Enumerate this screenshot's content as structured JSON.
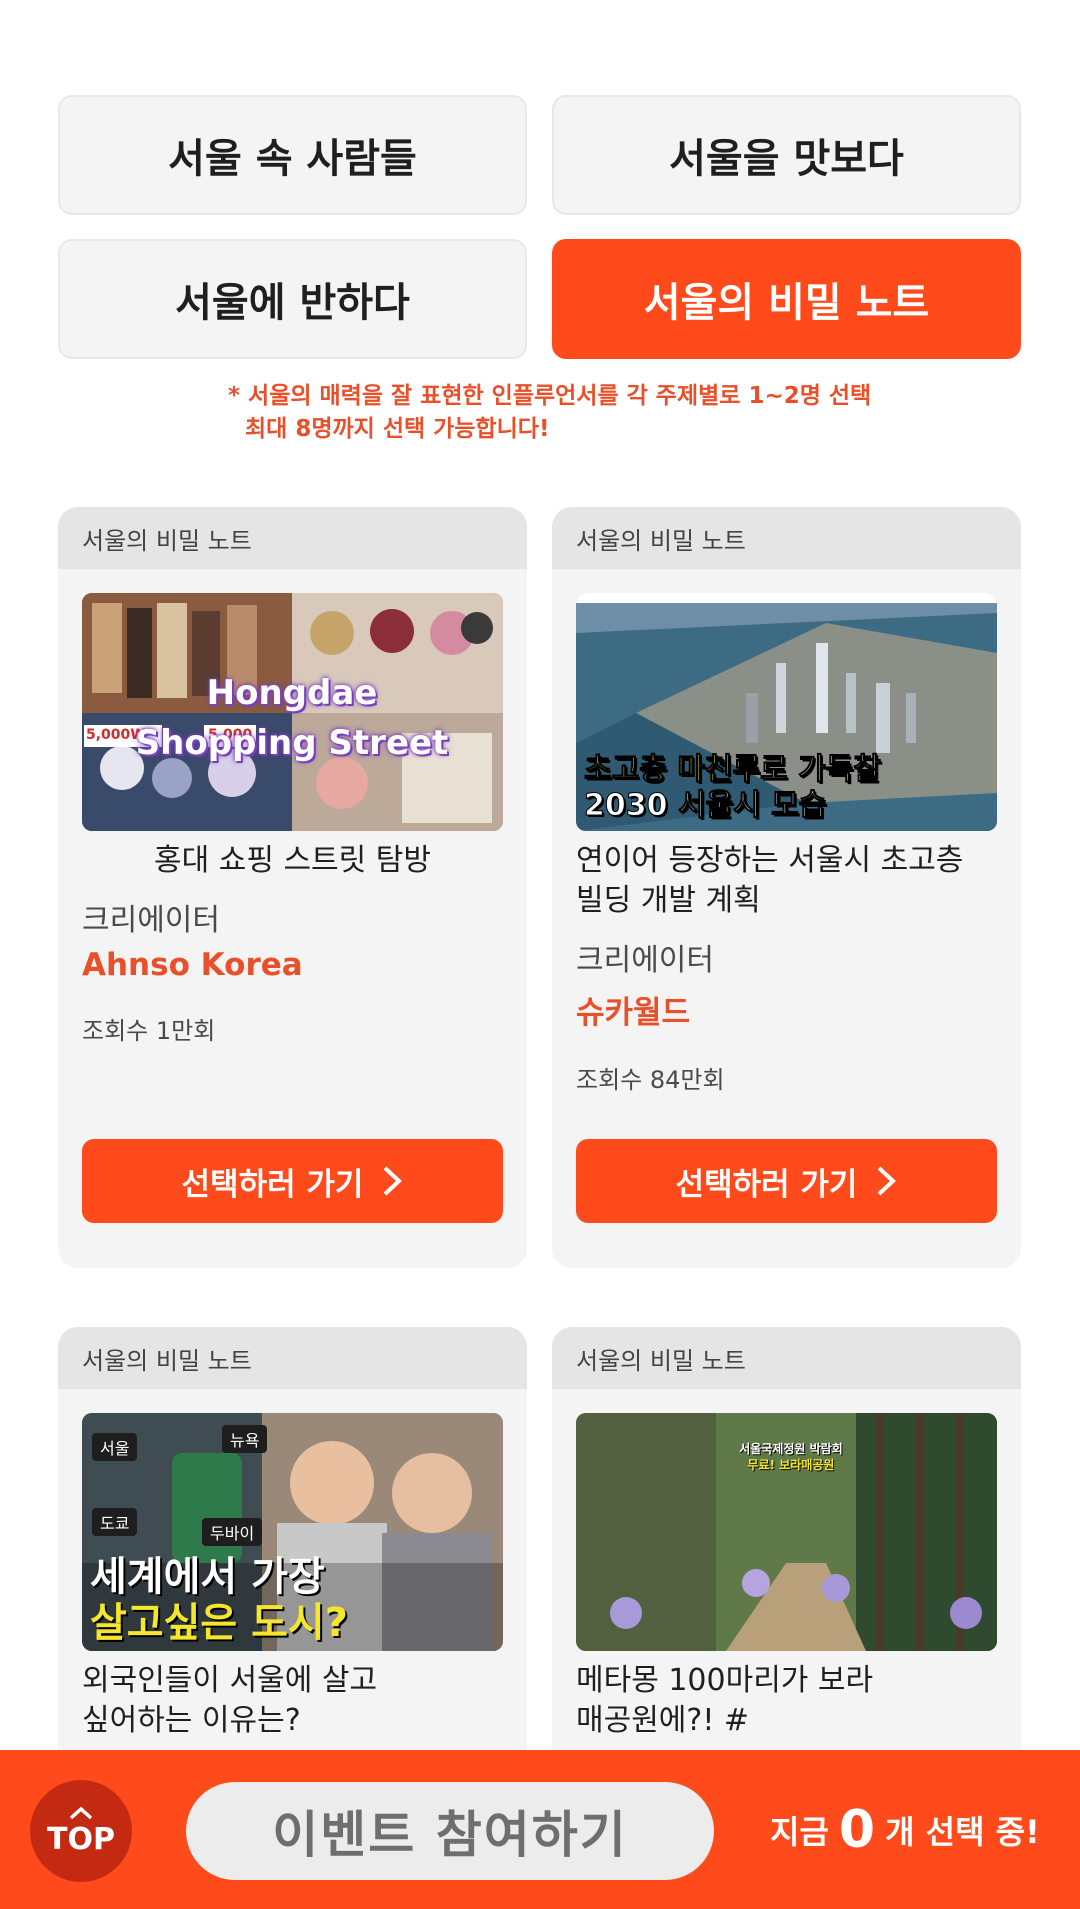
{
  "tabs": [
    {
      "label": "서울 속 사람들",
      "active": false
    },
    {
      "label": "서울을 맛보다",
      "active": false
    },
    {
      "label": "서울에 반하다",
      "active": false
    },
    {
      "label": "서울의 비밀 노트",
      "active": true
    }
  ],
  "notice": {
    "line1": "* 서울의 매력을 잘 표현한 인플루언서를 각 주제별로 1~2명 선택",
    "line2": "최대 8명까지 선택 가능합니다!"
  },
  "cards": [
    {
      "category": "서울의 비밀 노트",
      "thumb_caption": "Hongdae Shopping Street",
      "thumb_price_tags": [
        "5,000W",
        "5,000"
      ],
      "title": "홍대 쇼핑 스트릿 탐방",
      "creator_label": "크리에이터",
      "creator_name": "Ahnso Korea",
      "views": "조회수 1만회",
      "button_label": "선택하러 가기"
    },
    {
      "category": "서울의 비밀 노트",
      "thumb_caption_highlight": "초고층 마천루",
      "thumb_caption_rest": "로 가득찰",
      "thumb_caption_line2": "2030 서울시 모습",
      "title": "연이어 등장하는 서울시 초고층 빌딩 개발 계획",
      "creator_label": "크리에이터",
      "creator_name": "슈카월드",
      "views": "조회수 84만회",
      "button_label": "선택하러 가기"
    },
    {
      "category": "서울의 비밀 노트",
      "thumb_tags": [
        "서울",
        "뉴욕",
        "도쿄",
        "두바이"
      ],
      "thumb_caption_line1": "세계에서 가장",
      "thumb_caption_line2": "살고싶은 도시?",
      "title": "외국인들이 서울에 살고 싶어하는 이유는?"
    },
    {
      "category": "서울의 비밀 노트",
      "thumb_caption_line1": "서울국제정원 박람회",
      "thumb_caption_line2": "무료! 보라매공원",
      "title": "메타몽 100마리가 보라매공원에?! #"
    }
  ],
  "bottom_bar": {
    "top_label": "TOP",
    "event_label": "이벤트 참여하기",
    "count_prefix": "지금",
    "count": "0",
    "count_suffix": "개 선택 중!"
  },
  "colors": {
    "accent": "#ff4a1c",
    "notice": "#e9502a",
    "tab_bg": "#f4f4f4",
    "card_head": "#e5e5e5"
  }
}
